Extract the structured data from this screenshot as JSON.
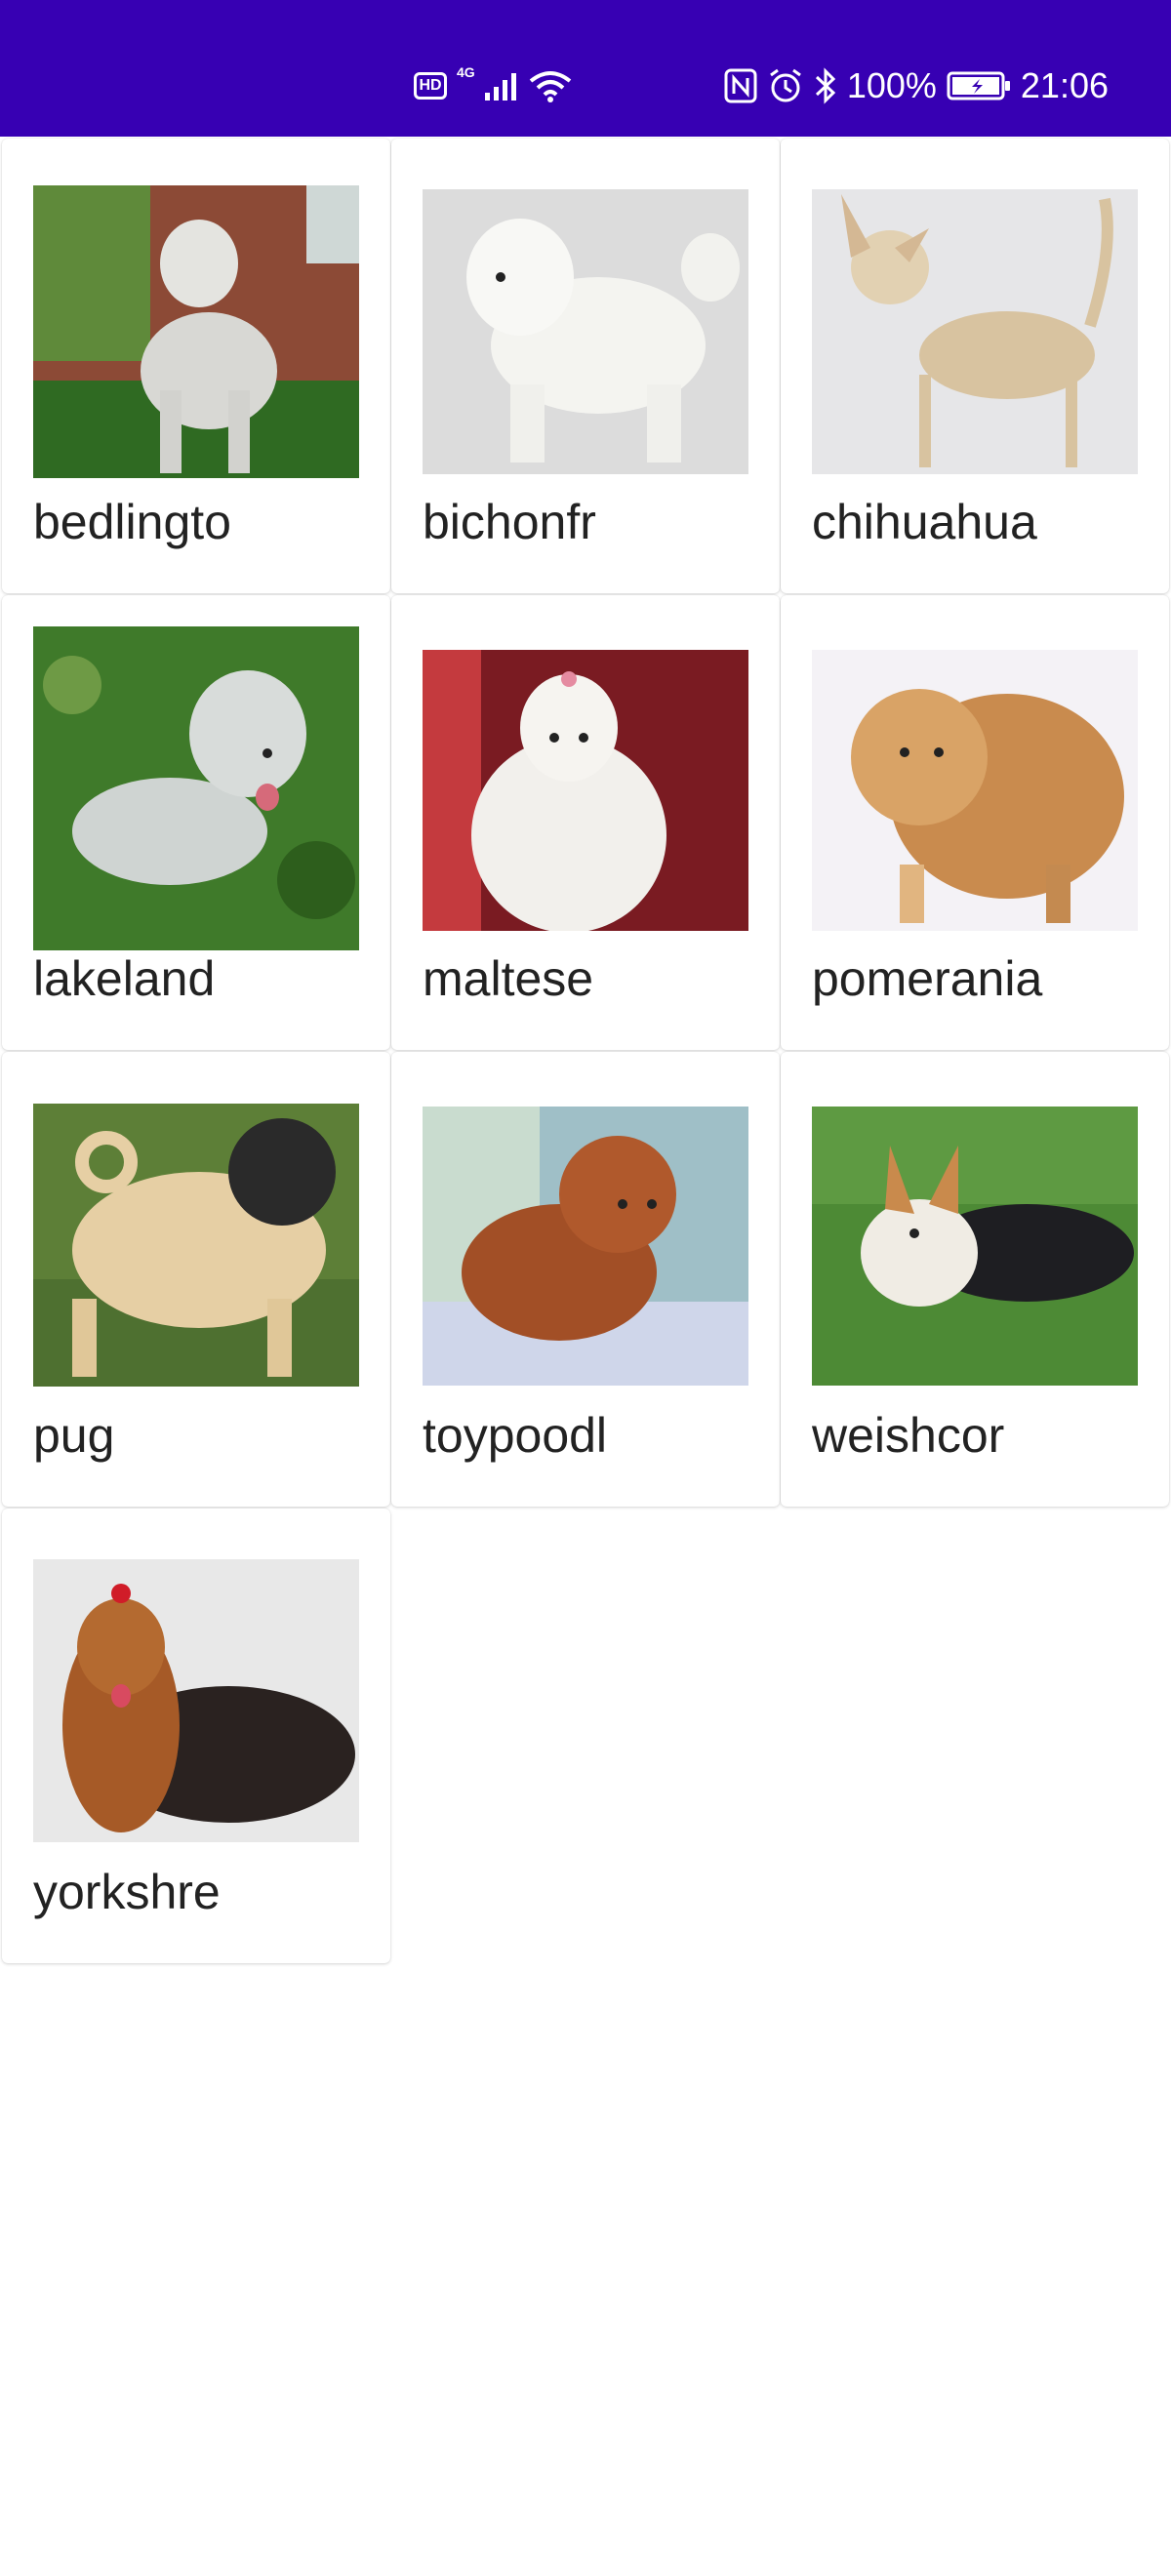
{
  "status_bar": {
    "network_badge": "HD",
    "network_type": "4G",
    "battery": "100%",
    "time": "21:06",
    "icons": [
      "hd-icon",
      "signal-icon",
      "wifi-icon",
      "nfc-icon",
      "alarm-icon",
      "bluetooth-icon",
      "battery-icon"
    ],
    "background_color": "#3700b3"
  },
  "breeds": [
    {
      "label": "bedlingto",
      "icon": "bedlington-terrier-photo"
    },
    {
      "label": "bichonfr",
      "icon": "bichon-frise-photo"
    },
    {
      "label": "chihuahua",
      "icon": "chihuahua-photo"
    },
    {
      "label": "lakeland",
      "icon": "lakeland-terrier-photo"
    },
    {
      "label": "maltese",
      "icon": "maltese-photo"
    },
    {
      "label": "pomerania",
      "icon": "pomeranian-photo"
    },
    {
      "label": "pug",
      "icon": "pug-photo"
    },
    {
      "label": "toypoodl",
      "icon": "toy-poodle-photo"
    },
    {
      "label": "weishcor",
      "icon": "welsh-corgi-photo"
    },
    {
      "label": "yorkshre",
      "icon": "yorkshire-terrier-photo"
    }
  ]
}
